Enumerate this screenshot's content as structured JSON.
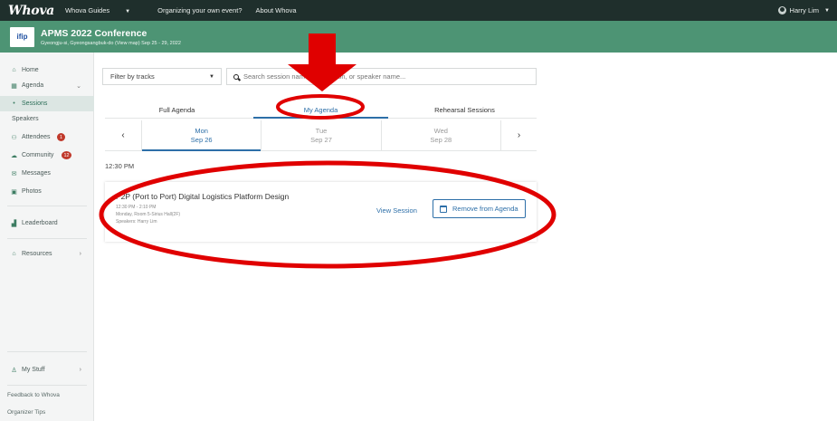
{
  "topbar": {
    "logo": "Whova",
    "nav": [
      "Whova Guides",
      "Organizing your own event?",
      "About Whova"
    ],
    "user_name": "Harry Lim"
  },
  "banner": {
    "logo_text": "ifip",
    "title": "APMS 2022 Conference",
    "subtitle": "Gyeongju-si, Gyeongsangbuk-do (View map)  Sep 25 - 29, 2022"
  },
  "sidebar": {
    "home": "Home",
    "agenda": "Agenda",
    "sessions": "Sessions",
    "speakers": "Speakers",
    "attendees": "Attendees",
    "attendees_badge": "1",
    "community": "Community",
    "community_badge": "12",
    "messages": "Messages",
    "photos": "Photos",
    "leaderboard": "Leaderboard",
    "resources": "Resources",
    "my_stuff": "My Stuff",
    "feedback": "Feedback to Whova",
    "organizer_tips": "Organizer Tips"
  },
  "filter": {
    "label": "Filter by tracks"
  },
  "search": {
    "placeholder": "Search session name, description, or speaker name..."
  },
  "tabs": [
    {
      "label": "Full Agenda"
    },
    {
      "label": "My Agenda"
    },
    {
      "label": "Rehearsal Sessions"
    }
  ],
  "days": [
    {
      "weekday": "Mon",
      "date": "Sep 26"
    },
    {
      "weekday": "Tue",
      "date": "Sep 27"
    },
    {
      "weekday": "Wed",
      "date": "Sep 28"
    }
  ],
  "time_slot": "12:30 PM",
  "session": {
    "title": "P2P (Port to Port) Digital Logistics Platform Design",
    "time": "12:30 PM - 2:10 PM",
    "location": "Monday, Room 5-Sirius Hall(2F)",
    "speakers": "Speakers: Harry Lim",
    "view_label": "View Session",
    "remove_label": "Remove from Agenda"
  },
  "colors": {
    "topbar": "#1f2f2c",
    "banner": "#4d9474",
    "accent": "#2d6fa8",
    "annotation": "#e00000"
  }
}
